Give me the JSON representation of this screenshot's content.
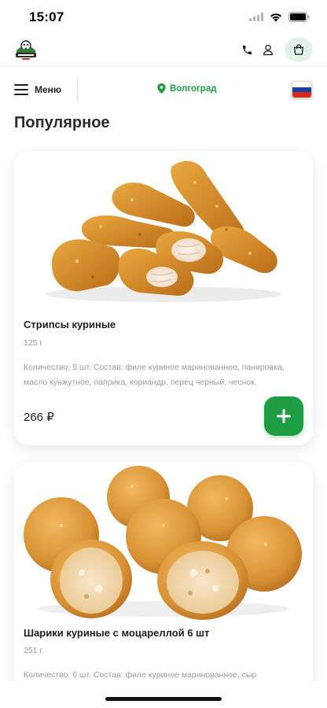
{
  "status_bar": {
    "time": "15:07"
  },
  "header": {
    "logo_icon": "brand-logo-icon",
    "phone_icon": "phone-icon",
    "user_icon": "user-icon",
    "cart_icon": "shopping-bag-icon",
    "cart_bg_color": "#e3f1e7"
  },
  "nav": {
    "menu_label": "Меню",
    "city_label": "Волгоград",
    "flag": "russia-flag-icon",
    "accent_color": "#1f9d45"
  },
  "section": {
    "title": "Популярное"
  },
  "products": [
    {
      "name": "Стрипсы куриные",
      "weight": "125 г",
      "description": "Количество: 5 шт. Состав: филе куриное маринованное, панировка, масло кунжутное, паприка, кориандр, перец черный, чеснок.",
      "price": "266 ₽",
      "add_label": "+"
    },
    {
      "name": "Шарики куриные с моцареллой 6 шт",
      "weight": "251 г",
      "description": "Количество: 6 шт. Состав: филе куриное маринованное, сыр",
      "add_label": "+"
    }
  ]
}
